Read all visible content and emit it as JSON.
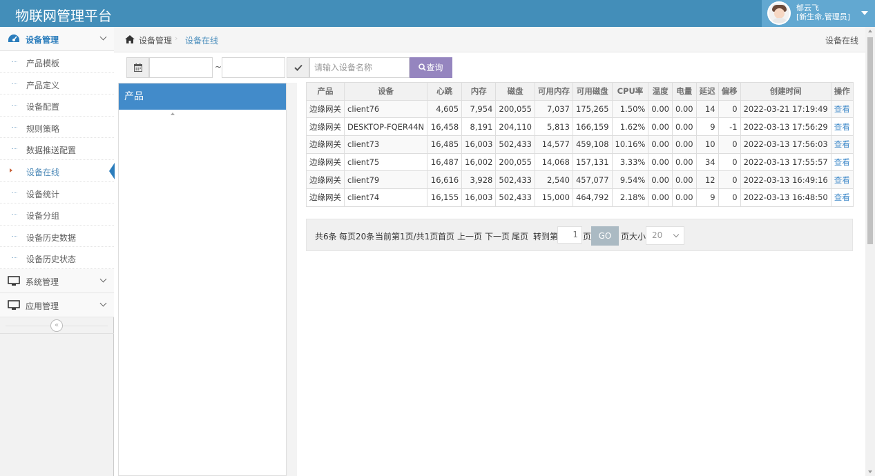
{
  "app": {
    "title": "物联网管理平台"
  },
  "user": {
    "name": "郁云飞",
    "role": "[新生命,管理员]"
  },
  "sidebar": {
    "device_mgmt": {
      "label": "设备管理",
      "items": [
        {
          "label": "产品模板"
        },
        {
          "label": "产品定义"
        },
        {
          "label": "设备配置"
        },
        {
          "label": "规则策略"
        },
        {
          "label": "数据推送配置"
        },
        {
          "label": "设备在线"
        },
        {
          "label": "设备统计"
        },
        {
          "label": "设备分组"
        },
        {
          "label": "设备历史数据"
        },
        {
          "label": "设备历史状态"
        }
      ]
    },
    "system_mgmt": {
      "label": "系统管理"
    },
    "app_mgmt": {
      "label": "应用管理"
    },
    "collapse_glyph": "«"
  },
  "breadcrumb": {
    "root": "设备管理",
    "current": "设备在线",
    "separator": "›"
  },
  "page_label": "设备在线",
  "filters": {
    "start_date": "",
    "end_date": "",
    "range_separator": "~",
    "device_placeholder": "请输入设备名称",
    "query_label": "查询"
  },
  "product_panel": {
    "title": "产品"
  },
  "table": {
    "headers": [
      "产品",
      "设备",
      "心跳",
      "内存",
      "磁盘",
      "可用内存",
      "可用磁盘",
      "CPU率",
      "温度",
      "电量",
      "延迟",
      "偏移",
      "创建时间",
      "操作"
    ],
    "rows": [
      [
        "边缘网关",
        "client76",
        "4,605",
        "7,954",
        "200,055",
        "7,037",
        "175,265",
        "1.50%",
        "0.00",
        "0.00",
        "14",
        "0",
        "2022-03-21 17:19:49",
        "查看"
      ],
      [
        "边缘网关",
        "DESKTOP-FQER44N",
        "16,458",
        "8,191",
        "204,110",
        "5,813",
        "166,159",
        "1.62%",
        "0.00",
        "0.00",
        "9",
        "-1",
        "2022-03-13 17:56:29",
        "查看"
      ],
      [
        "边缘网关",
        "client73",
        "16,485",
        "16,003",
        "502,433",
        "14,577",
        "459,108",
        "10.16%",
        "0.00",
        "0.00",
        "10",
        "0",
        "2022-03-13 17:56:03",
        "查看"
      ],
      [
        "边缘网关",
        "client75",
        "16,487",
        "16,002",
        "200,055",
        "14,068",
        "157,131",
        "3.33%",
        "0.00",
        "0.00",
        "34",
        "0",
        "2022-03-13 17:55:57",
        "查看"
      ],
      [
        "边缘网关",
        "client79",
        "16,616",
        "3,928",
        "502,433",
        "2,540",
        "457,077",
        "9.54%",
        "0.00",
        "0.00",
        "12",
        "0",
        "2022-03-13 16:49:16",
        "查看"
      ],
      [
        "边缘网关",
        "client74",
        "16,155",
        "16,003",
        "502,433",
        "15,000",
        "464,792",
        "2.18%",
        "0.00",
        "0.00",
        "9",
        "0",
        "2022-03-13 16:48:50",
        "查看"
      ]
    ]
  },
  "pager": {
    "total": "共6条",
    "per_page": "每页20条",
    "current": "当前第1页/共1页",
    "first": "首页",
    "prev": "上一页",
    "next": "下一页",
    "last": "尾页",
    "goto_prefix": "转到第",
    "goto_value": "1",
    "goto_suffix": "页",
    "go": "GO",
    "size_label": "页大小",
    "size_value": "20"
  },
  "colors": {
    "navbar": "#438eb9",
    "accent": "#428bca",
    "query_button": "#9585bf",
    "go_button": "#abbac3"
  }
}
